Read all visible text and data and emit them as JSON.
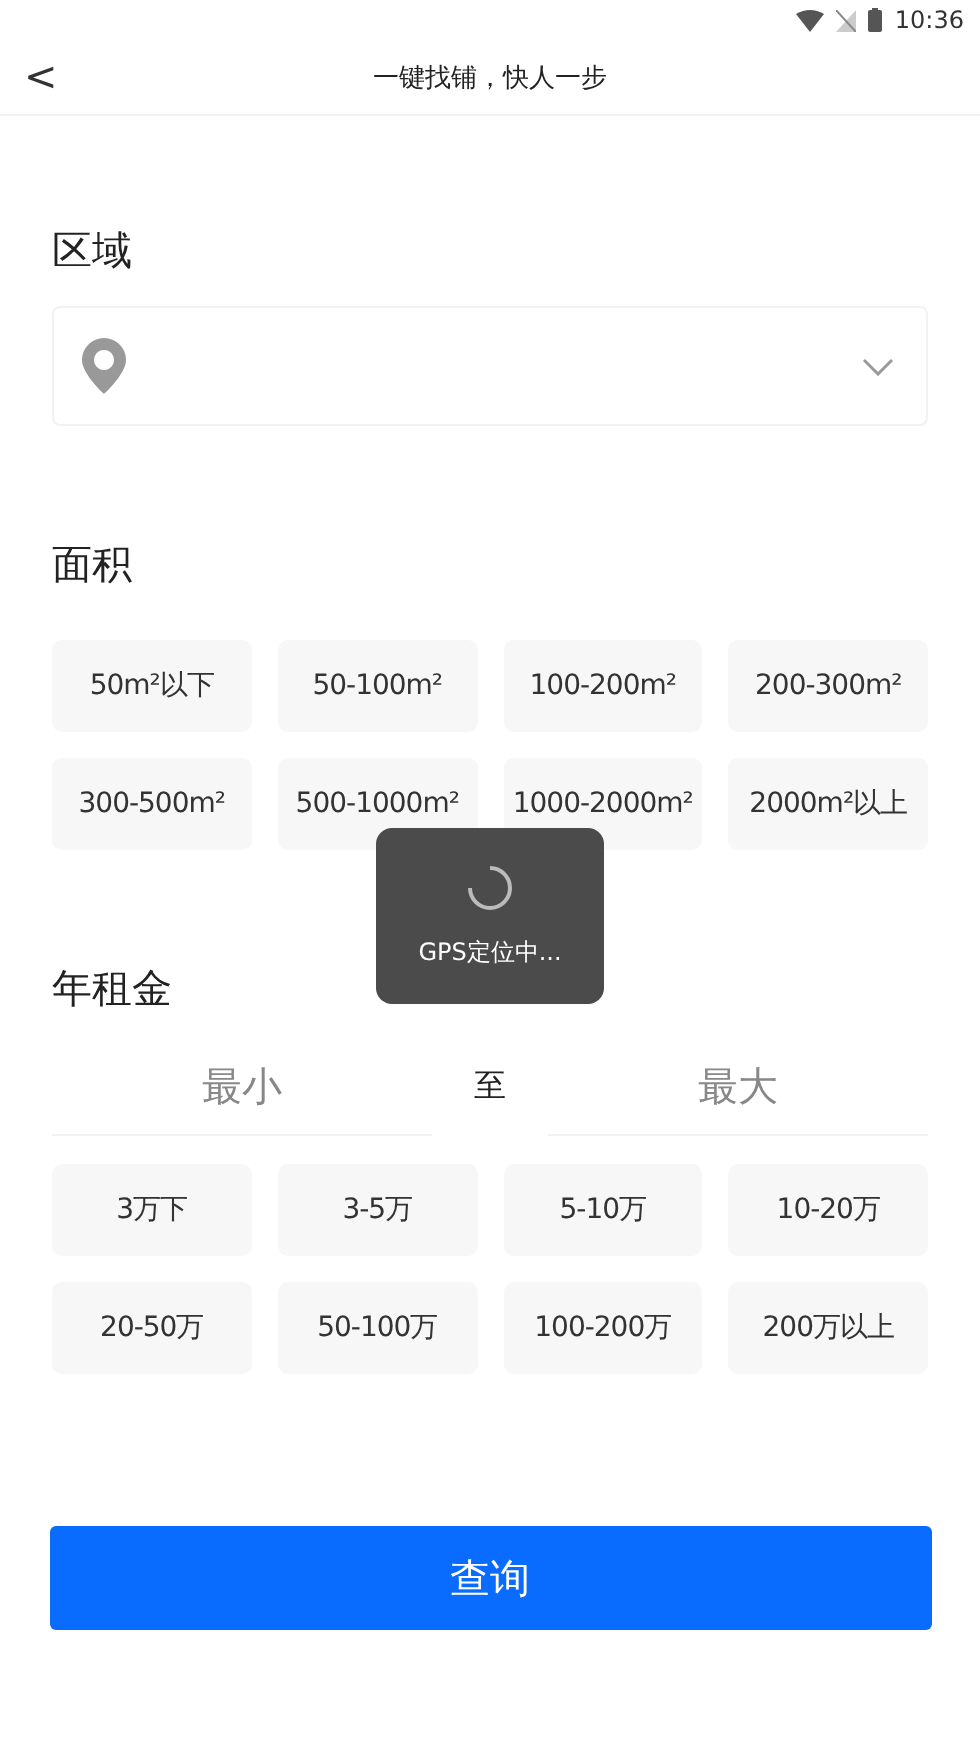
{
  "status_bar": {
    "time": "10:36"
  },
  "header": {
    "back": "<",
    "title": "一键找铺，快人一步"
  },
  "region": {
    "label": "区域"
  },
  "area": {
    "label": "面积",
    "options": [
      {
        "label": "50m²以下",
        "selected": false
      },
      {
        "label": "50-100m²",
        "selected": false
      },
      {
        "label": "100-200m²",
        "selected": false
      },
      {
        "label": "200-300m²",
        "selected": false
      },
      {
        "label": "300-500m²",
        "selected": false
      },
      {
        "label": "500-1000m²",
        "selected": false
      },
      {
        "label": "1000-2000m²",
        "selected": false
      },
      {
        "label": "2000m²以上",
        "selected": false
      }
    ]
  },
  "rent": {
    "label": "年租金",
    "min_placeholder": "最小",
    "separator": "至",
    "max_placeholder": "最大",
    "options": [
      {
        "label": "3万下",
        "selected": false
      },
      {
        "label": "3-5万",
        "selected": false
      },
      {
        "label": "5-10万",
        "selected": false
      },
      {
        "label": "10-20万",
        "selected": false
      },
      {
        "label": "20-50万",
        "selected": false
      },
      {
        "label": "50-100万",
        "selected": false
      },
      {
        "label": "100-200万",
        "selected": false
      },
      {
        "label": "200万以上",
        "selected": false
      }
    ]
  },
  "submit": "查询",
  "toast": {
    "text": "GPS定位中..."
  }
}
